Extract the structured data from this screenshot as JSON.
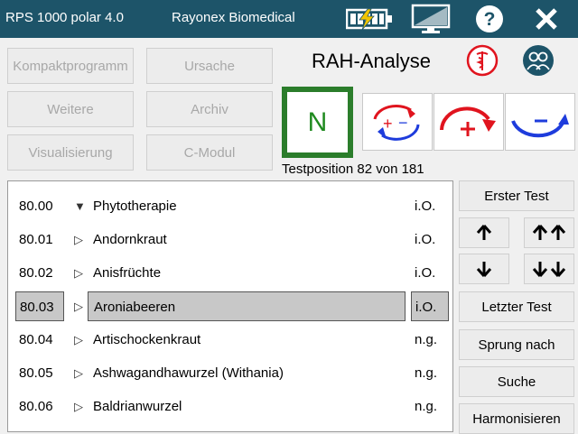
{
  "titlebar": {
    "app_title": "RPS 1000 polar 4.0",
    "vendor": "Rayonex Biomedical",
    "icons": [
      "battery-icon",
      "monitor-icon",
      "help-icon",
      "close-icon"
    ],
    "help_label": "?",
    "close_label": "✕"
  },
  "menu": {
    "kompakt": "Kompaktprogramm",
    "ursache": "Ursache",
    "weitere": "Weitere",
    "archiv": "Archiv",
    "visualisierung": "Visualisierung",
    "cmodul": "C-Modul"
  },
  "heading": "RAH-Analyse",
  "tools": {
    "n_label": "N",
    "plus_minus": "+ −",
    "plus": "+",
    "minus": "−"
  },
  "test_position": "Testposition 82 von 181",
  "list": [
    {
      "num": "80.00",
      "tri": "▼",
      "name": "Phytotherapie",
      "status": "i.O.",
      "selected": false
    },
    {
      "num": "80.01",
      "tri": "▷",
      "name": "Andornkraut",
      "status": "i.O.",
      "selected": false
    },
    {
      "num": "80.02",
      "tri": "▷",
      "name": "Anisfrüchte",
      "status": "i.O.",
      "selected": false
    },
    {
      "num": "80.03",
      "tri": "▷",
      "name": "Aroniabeeren",
      "status": "i.O.",
      "selected": true
    },
    {
      "num": "80.04",
      "tri": "▷",
      "name": "Artischockenkraut",
      "status": "n.g.",
      "selected": false
    },
    {
      "num": "80.05",
      "tri": "▷",
      "name": "Ashwagandhawurzel (Withania)",
      "status": "n.g.",
      "selected": false
    },
    {
      "num": "80.06",
      "tri": "▷",
      "name": "Baldrianwurzel",
      "status": "n.g.",
      "selected": false
    }
  ],
  "right": {
    "erster": "Erster Test",
    "up": "🡑",
    "upup": "🡑🡑",
    "down": "🡓",
    "downdown": "🡓🡓",
    "letzter": "Letzter Test",
    "sprung": "Sprung nach",
    "suche": "Suche",
    "harmonisieren": "Harmonisieren"
  },
  "colors": {
    "titlebar": "#1d5469",
    "n_border": "#2b7d2b",
    "red": "#e0141e",
    "blue": "#1e3cdc",
    "selected_row": "#c8c8c8"
  }
}
